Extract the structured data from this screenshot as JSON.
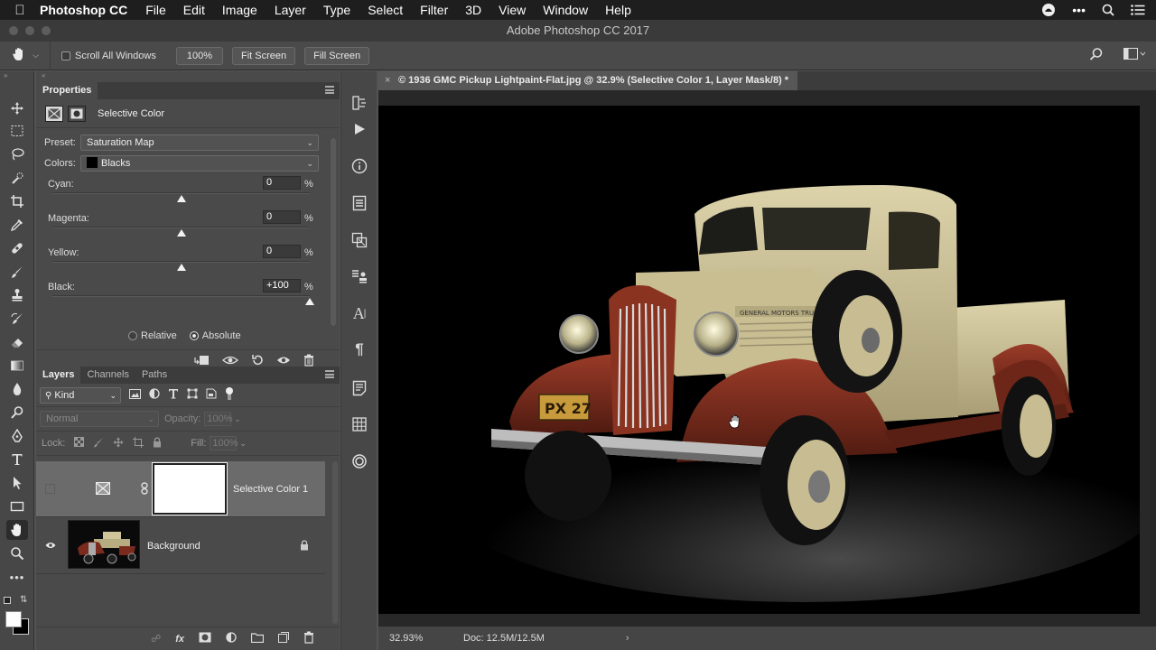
{
  "menubar": {
    "app_name": "Photoshop CC",
    "items": [
      "File",
      "Edit",
      "Image",
      "Layer",
      "Type",
      "Select",
      "Filter",
      "3D",
      "View",
      "Window",
      "Help"
    ]
  },
  "window": {
    "title": "Adobe Photoshop CC 2017"
  },
  "options": {
    "scroll_all_windows": "Scroll All Windows",
    "zoom_button": "100%",
    "fit_screen": "Fit Screen",
    "fill_screen": "Fill Screen"
  },
  "properties": {
    "tab": "Properties",
    "title": "Selective Color",
    "preset_label": "Preset:",
    "preset_value": "Saturation Map",
    "colors_label": "Colors:",
    "colors_value": "Blacks",
    "sliders": [
      {
        "label": "Cyan:",
        "value": "0",
        "fraction": 0.5
      },
      {
        "label": "Magenta:",
        "value": "0",
        "fraction": 0.5
      },
      {
        "label": "Yellow:",
        "value": "0",
        "fraction": 0.5
      },
      {
        "label": "Black:",
        "value": "+100",
        "fraction": 1.0
      }
    ],
    "percent": "%",
    "relative": "Relative",
    "absolute": "Absolute",
    "method_selected": "Absolute"
  },
  "layers_panel": {
    "tabs": [
      "Layers",
      "Channels",
      "Paths"
    ],
    "kind": "Kind",
    "blend_mode": "Normal",
    "opacity_label": "Opacity:",
    "opacity_value": "100%",
    "lock_label": "Lock:",
    "fill_label": "Fill:",
    "fill_value": "100%",
    "layers": [
      {
        "name": "Selective Color 1",
        "visible": false,
        "selected": true
      },
      {
        "name": "Background",
        "visible": true,
        "selected": false,
        "locked": true
      }
    ]
  },
  "document": {
    "tab_title": "© 1936 GMC Pickup Lightpaint-Flat.jpg @ 32.9% (Selective Color 1, Layer Mask/8) *",
    "plate_text": "PX 27",
    "hood_text": "GENERAL MOTORS TRUCK",
    "status_zoom": "32.93%",
    "status_doc": "Doc: 12.5M/12.5M"
  },
  "colors": {
    "truck_cream": "#cfc49a",
    "truck_red": "#7a2b1d",
    "canvas_bg": "#000000"
  }
}
